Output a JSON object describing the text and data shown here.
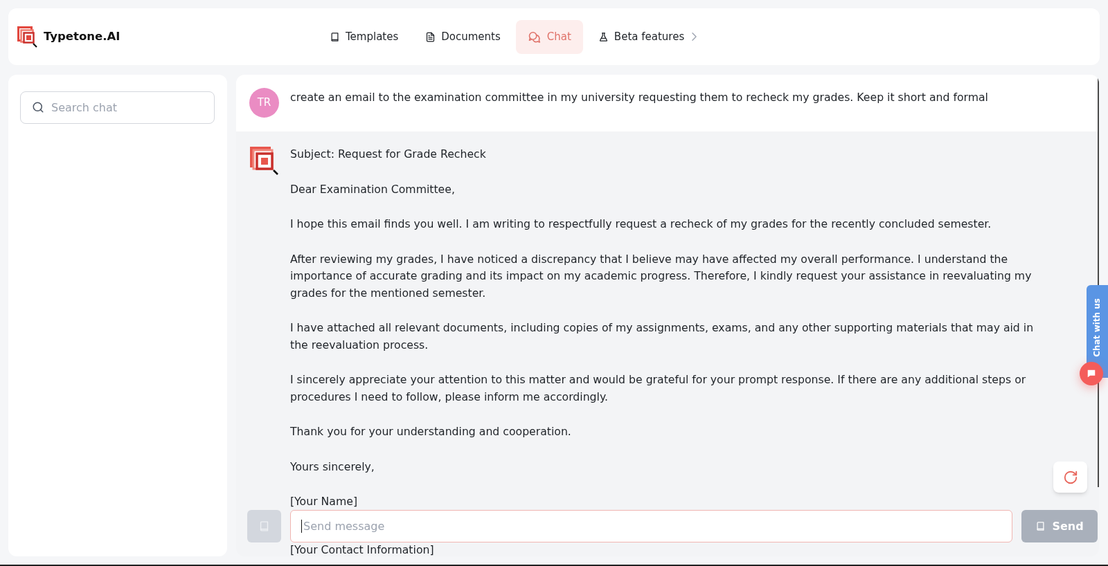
{
  "app": {
    "name": "Typetone.AI"
  },
  "nav": [
    {
      "label": "Templates",
      "kind": "book",
      "selected": false,
      "submenu": false
    },
    {
      "label": "Documents",
      "kind": "document",
      "selected": false,
      "submenu": false
    },
    {
      "label": "Chat",
      "kind": "chat",
      "selected": true,
      "submenu": false
    },
    {
      "label": "Beta features",
      "kind": "flask",
      "selected": false,
      "submenu": true
    }
  ],
  "sidebar": {
    "search": {
      "placeholder": "Search chat"
    }
  },
  "conversation": [
    {
      "kind": "user",
      "avatar": "TR",
      "text": "create an email to the examination committee in my university requesting them to recheck my grades. Keep it short and formal"
    },
    {
      "kind": "assistant",
      "paragraphs": [
        "Subject: Request for Grade Recheck",
        "Dear Examination Committee,",
        "I hope this email finds you well. I am writing to respectfully request a recheck of my grades for the recently concluded semester.",
        "After reviewing my grades, I have noticed a discrepancy that I believe may have affected my overall performance. I understand the importance of accurate grading and its impact on my academic progress. Therefore, I kindly request your assistance in reevaluating my grades for the mentioned semester.",
        "I have attached all relevant documents, including copies of my assignments, exams, and any other supporting materials that may aid in the reevaluation process.",
        "I sincerely appreciate your attention to this matter and would be grateful for your prompt response. If there are any additional steps or procedures I need to follow, please inform me accordingly.",
        "Thank you for your understanding and cooperation.",
        "Yours sincerely,"
      ],
      "signature": [
        "[Your Name]",
        "[Your Contact Information]"
      ]
    }
  ],
  "composer": {
    "placeholder": "Send message",
    "template_button": {
      "disabled": true
    },
    "send_button": {
      "label": "Send",
      "disabled": true
    }
  },
  "widgets": {
    "chat_with_us": {
      "label": "Chat with us"
    }
  }
}
